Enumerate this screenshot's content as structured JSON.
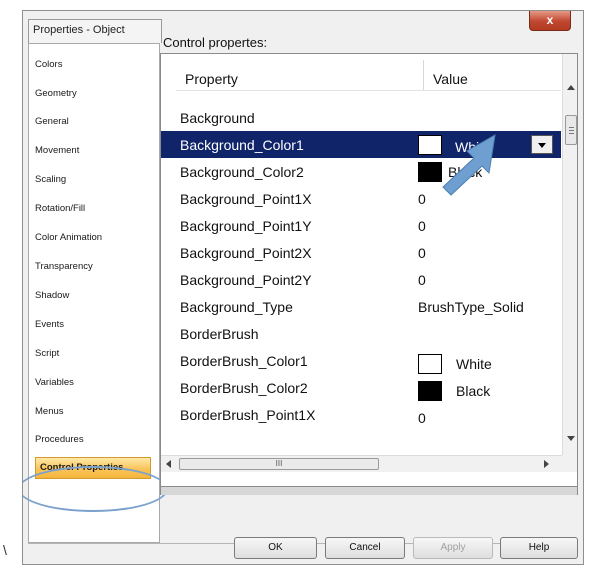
{
  "window": {
    "title": "Properties - Object",
    "close_label": "x"
  },
  "sidebar": {
    "items": [
      {
        "label": "Colors"
      },
      {
        "label": "Geometry"
      },
      {
        "label": "General"
      },
      {
        "label": "Movement"
      },
      {
        "label": "Scaling"
      },
      {
        "label": "Rotation/Fill"
      },
      {
        "label": "Color Animation"
      },
      {
        "label": "Transparency"
      },
      {
        "label": "Shadow"
      },
      {
        "label": "Events"
      },
      {
        "label": "Script"
      },
      {
        "label": "Variables"
      },
      {
        "label": "Menus"
      },
      {
        "label": "Procedures"
      },
      {
        "label": "Control Properties",
        "active": true
      }
    ]
  },
  "main": {
    "group_label": "Control propertes:",
    "columns": {
      "property": "Property",
      "value": "Value"
    },
    "rows": [
      {
        "name": "Background",
        "value": ""
      },
      {
        "name": "Background_Color1",
        "value": "White",
        "swatch": "white",
        "selected": true
      },
      {
        "name": "Background_Color2",
        "value": "Black",
        "swatch": "black"
      },
      {
        "name": "Background_Point1X",
        "value": "0"
      },
      {
        "name": "Background_Point1Y",
        "value": "0"
      },
      {
        "name": "Background_Point2X",
        "value": "0"
      },
      {
        "name": "Background_Point2Y",
        "value": "0"
      },
      {
        "name": "Background_Type",
        "value": "BrushType_Solid"
      },
      {
        "name": "BorderBrush",
        "value": ""
      },
      {
        "name": "BorderBrush_Color1",
        "value": "White",
        "swatch": "white"
      },
      {
        "name": "BorderBrush_Color2",
        "value": "Black",
        "swatch": "black"
      },
      {
        "name": "BorderBrush_Point1X",
        "value": "0"
      }
    ],
    "hscroll_grip": "III"
  },
  "footer": {
    "ok": "OK",
    "cancel": "Cancel",
    "apply": "Apply",
    "help": "Help"
  },
  "stray_mark": "\\",
  "colors": {
    "selection": "#10246a",
    "active_tab": "#f6b63c",
    "highlight_circle": "#7aa2cc",
    "pointer_arrow": "#6f9fd0"
  }
}
